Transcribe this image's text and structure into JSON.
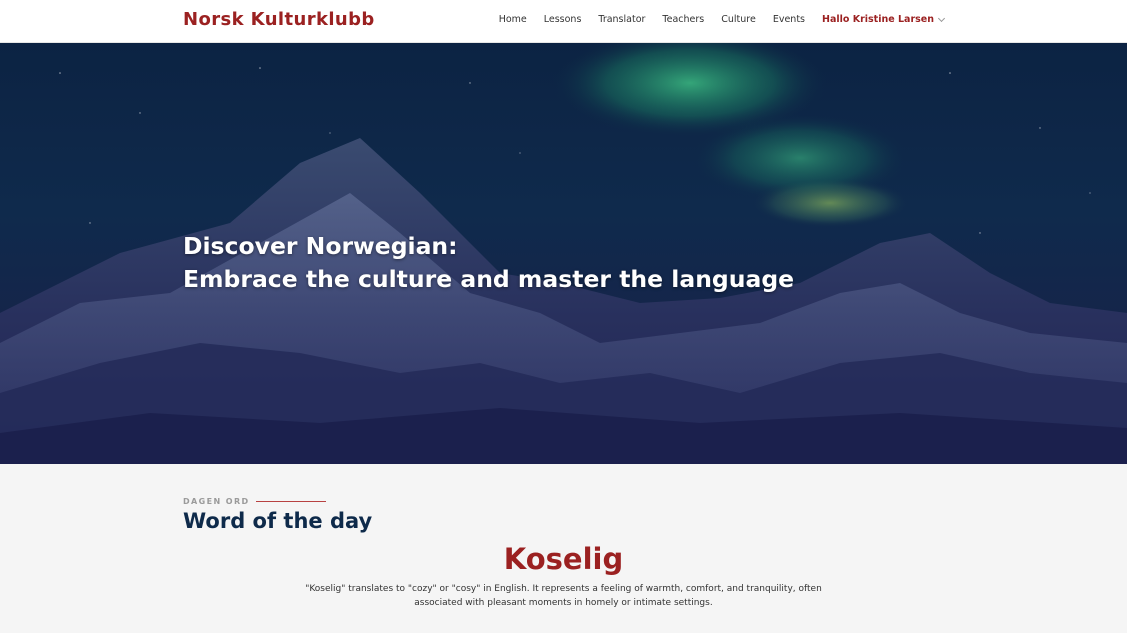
{
  "header": {
    "brand": "Norsk Kulturklubb",
    "nav": [
      "Home",
      "Lessons",
      "Translator",
      "Teachers",
      "Culture",
      "Events"
    ],
    "user_greeting": "Hallo Kristine Larsen"
  },
  "hero": {
    "line1": "Discover Norwegian:",
    "line2": "Embrace the culture and master the language"
  },
  "word_of_day": {
    "eyebrow": "DAGEN ORD",
    "title": "Word of the day",
    "word": "Koselig",
    "description": "\"Koselig\" translates to \"cozy\" or \"cosy\" in English. It represents a feeling of warmth, comfort, and tranquility, often associated with pleasant moments in homely or intimate settings."
  },
  "colors": {
    "brand": "#9b2121",
    "navy": "#0e2a4a",
    "aurora": "#3fbf7a"
  },
  "icons": {
    "user_menu": "chevron-down-icon"
  }
}
